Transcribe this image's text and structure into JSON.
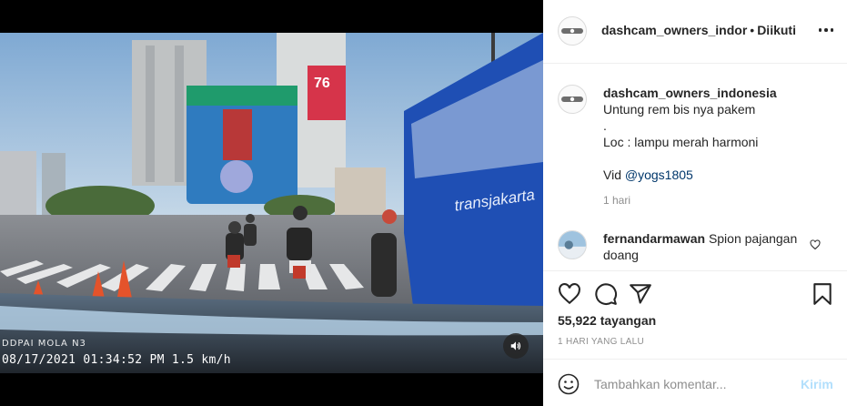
{
  "post": {
    "username": "dashcam_owners_indor",
    "separator": "•",
    "follow_status": "Diikuti",
    "more_icon": "more-horizontal-icon"
  },
  "caption": {
    "username": "dashcam_owners_indonesia",
    "line1": "Untung rem bis nya pakem",
    "line2": ".",
    "line3": "Loc : lampu merah harmoni",
    "vid_prefix": "Vid ",
    "mention": "@yogs1805",
    "time": "1 hari"
  },
  "comment": {
    "username": "fernandarmawan",
    "text": "Spion pajangan doang",
    "like_icon": "heart-outline-icon"
  },
  "actions": {
    "like_icon": "heart-outline-icon",
    "comment_icon": "comment-bubble-icon",
    "share_icon": "paper-plane-icon",
    "save_icon": "bookmark-icon"
  },
  "stats": {
    "views": "55,922 tayangan",
    "time_ago": "1 HARI YANG LALU"
  },
  "add_comment": {
    "placeholder": "Tambahkan komentar...",
    "post_label": "Kirim",
    "emoji_icon": "emoji-smile-icon"
  },
  "video": {
    "dashcam_brand": "DDPAI MOLA N3",
    "timestamp": "08/17/2021 01:34:52 PM 1.5 km/h",
    "sound_icon": "speaker-icon",
    "bus_text": "transjakarta",
    "billboard_text": "76"
  },
  "colors": {
    "accent_link": "#00376b",
    "post_button_disabled": "#b2dffc",
    "muted_text": "#8e8e8e",
    "bus_blue": "#1f4fb4"
  }
}
